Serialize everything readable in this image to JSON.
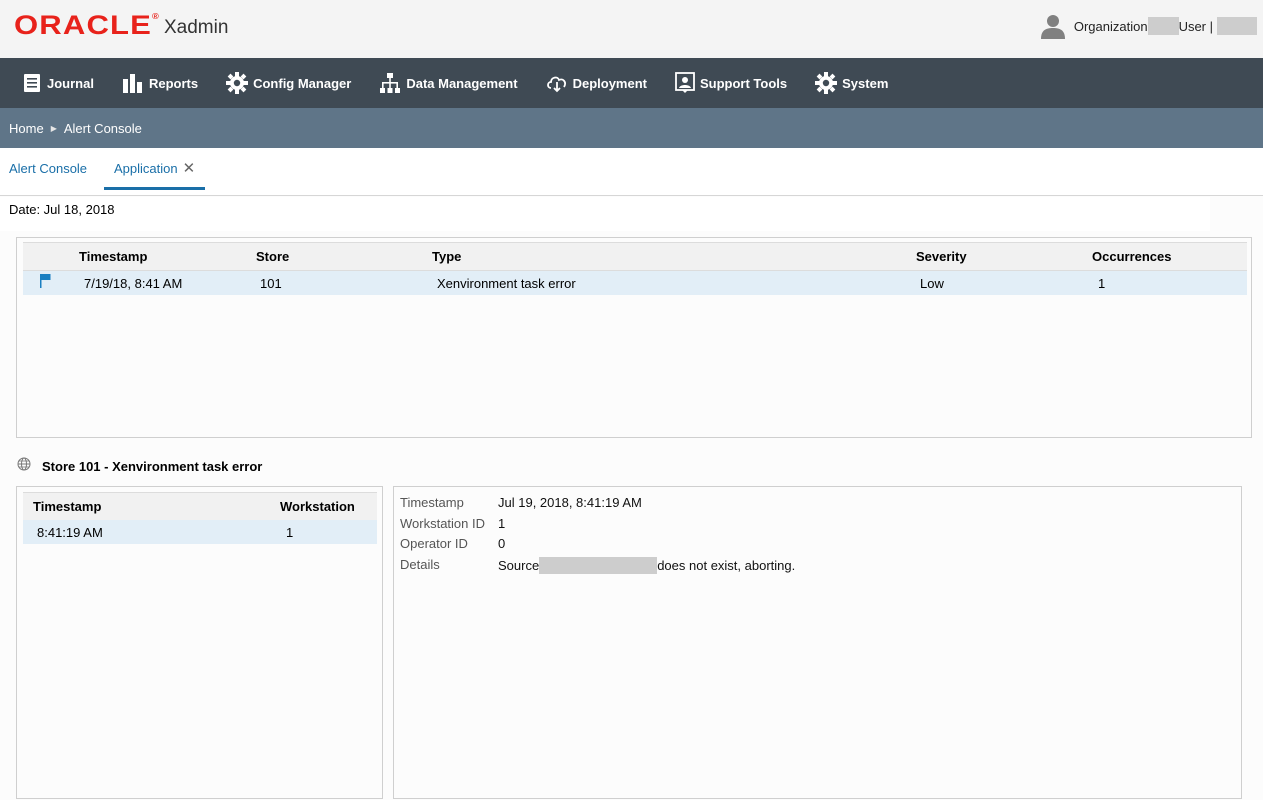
{
  "header": {
    "logo": "ORACLE",
    "app_title": "Xadmin",
    "org_label": "Organization",
    "user_label": "User |"
  },
  "nav": {
    "items": [
      {
        "label": "Journal",
        "icon": "journal-icon"
      },
      {
        "label": "Reports",
        "icon": "reports-icon"
      },
      {
        "label": "Config Manager",
        "icon": "gear-icon"
      },
      {
        "label": "Data Management",
        "icon": "hierarchy-icon"
      },
      {
        "label": "Deployment",
        "icon": "cloud-download-icon"
      },
      {
        "label": "Support Tools",
        "icon": "support-icon"
      },
      {
        "label": "System",
        "icon": "gear-icon"
      }
    ]
  },
  "breadcrumb": [
    "Home",
    "Alert Console"
  ],
  "tabs": [
    {
      "label": "Alert Console",
      "active": false
    },
    {
      "label": "Application",
      "active": true,
      "closable": true
    }
  ],
  "date_line": "Date: Jul 18, 2018",
  "alerts_table": {
    "columns": [
      "Timestamp",
      "Store",
      "Type",
      "Severity",
      "Occurrences"
    ],
    "rows": [
      {
        "timestamp": "7/19/18, 8:41 AM",
        "store": "101",
        "type": "Xenvironment task error",
        "severity": "Low",
        "occurrences": "1",
        "flag_color": "#1a7fc1"
      }
    ]
  },
  "detail_title": "Store 101 - Xenvironment task error",
  "occurrences_table": {
    "columns": [
      "Timestamp",
      "Workstation"
    ],
    "rows": [
      {
        "timestamp": "8:41:19 AM",
        "workstation": "1"
      }
    ]
  },
  "details": {
    "timestamp_label": "Timestamp",
    "timestamp_value": "Jul 19, 2018, 8:41:19 AM",
    "workstation_label": "Workstation ID",
    "workstation_value": "1",
    "operator_label": "Operator ID",
    "operator_value": "0",
    "details_label": "Details",
    "details_prefix": "Source",
    "details_suffix": "does not exist, aborting."
  },
  "colors": {
    "brand_red": "#e8221b",
    "nav_bg": "#3f4a54",
    "breadcrumb_bg": "#5f7588",
    "accent_blue": "#1a6fa8",
    "selected_row": "#e2eef7"
  }
}
